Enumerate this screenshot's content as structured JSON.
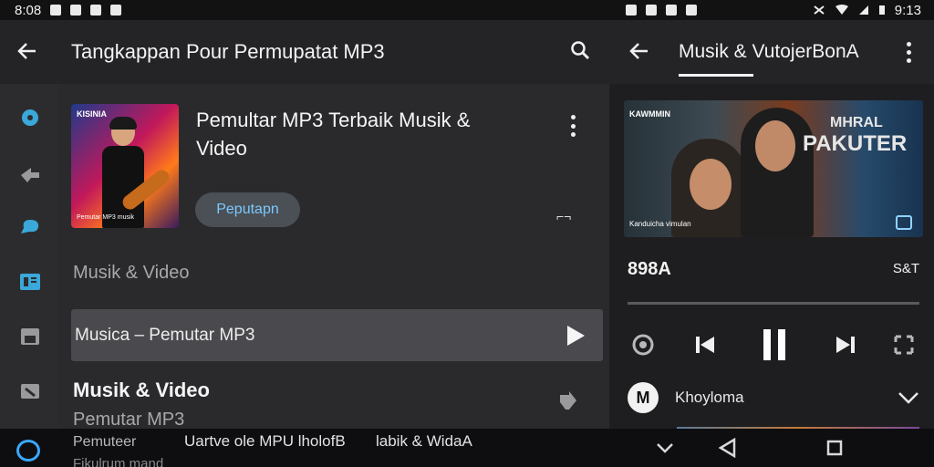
{
  "status_left": {
    "time": "8:08"
  },
  "status_right": {
    "time": "9:13"
  },
  "left_pane": {
    "appbar_title": "Tangkappan Pour Permupatat MP3",
    "song_title": "Pemultar MP3 Terbaik Musik & Video",
    "card_logo": "KISINIA",
    "card_caption": "Pemutar MP3 musik",
    "pill_label": "Peputapn",
    "section_label": "Musik & Video",
    "highlight_row": "Musica – Pemutar MP3",
    "row2_title": "Musik & Video",
    "row2_sub": "Pemutar MP3"
  },
  "right_pane": {
    "appbar_title": "Musik & VutojerBonA",
    "banner_tag": "KAWMMIN",
    "banner_big1": "MHRAL",
    "banner_big2": "PAKUTER",
    "banner_caption": "Kanduicha vimulan",
    "time_left": "898A",
    "time_right": "S&T",
    "progress": 0.0,
    "artist_avatar": "M",
    "artist_name": "Khoyloma"
  },
  "bottom_bar": {
    "text1": "Pemuteer",
    "text2": "Uartve ole MPU lholofB",
    "text3": "labik & WidaA",
    "text4": "Fikulrum mand"
  },
  "colors": {
    "accent_blue": "#3aa8ff",
    "pill_text": "#7cc8ff",
    "background": "#2a2a2d"
  },
  "icons": {
    "rail": [
      "gear-icon",
      "pointer-icon",
      "chat-bubble-icon",
      "book-icon",
      "save-icon",
      "tag-icon"
    ]
  }
}
